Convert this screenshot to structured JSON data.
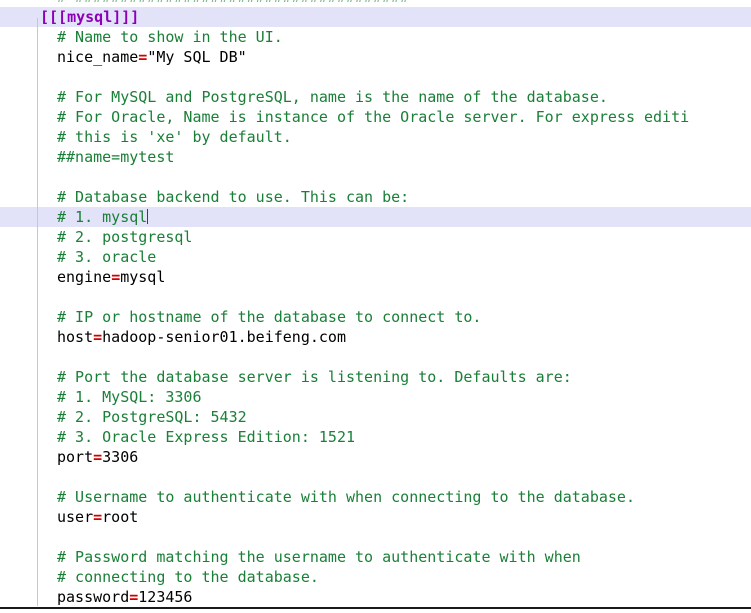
{
  "app": {
    "kind": "text-editor",
    "file_type": "ini-config",
    "background": "#ffffff",
    "highlight_color": "#e2e2f8",
    "comment_color": "#1a7f37",
    "section_color": "#8e00b8",
    "equals_color": "#d00000",
    "caret_color": "#3b2fb0"
  },
  "editor": {
    "clipped_top_line": "# #####################################",
    "lines": [
      {
        "id": "l1",
        "kind": "section",
        "indent": false,
        "highlight": true,
        "text": "[[[mysql]]]"
      },
      {
        "id": "l2",
        "kind": "comment",
        "indent": true,
        "highlight": false,
        "text": "# Name to show in the UI."
      },
      {
        "id": "l3",
        "kind": "assign",
        "indent": true,
        "highlight": false,
        "key": "nice_name",
        "eq": "=",
        "value": "\"My SQL DB\""
      },
      {
        "id": "l4",
        "kind": "blank",
        "indent": true,
        "highlight": false,
        "text": ""
      },
      {
        "id": "l5",
        "kind": "comment",
        "indent": true,
        "highlight": false,
        "text": "# For MySQL and PostgreSQL, name is the name of the database."
      },
      {
        "id": "l6",
        "kind": "comment",
        "indent": true,
        "highlight": false,
        "text": "# For Oracle, Name is instance of the Oracle server. For express editi"
      },
      {
        "id": "l7",
        "kind": "comment",
        "indent": true,
        "highlight": false,
        "text": "# this is 'xe' by default."
      },
      {
        "id": "l8",
        "kind": "comment",
        "indent": true,
        "highlight": false,
        "text": "##name=mytest"
      },
      {
        "id": "l9",
        "kind": "blank",
        "indent": true,
        "highlight": false,
        "text": ""
      },
      {
        "id": "l10",
        "kind": "comment",
        "indent": true,
        "highlight": false,
        "text": "# Database backend to use. This can be:"
      },
      {
        "id": "l11",
        "kind": "comment",
        "indent": true,
        "highlight": true,
        "caret": true,
        "text": "# 1. mysql"
      },
      {
        "id": "l12",
        "kind": "comment",
        "indent": true,
        "highlight": false,
        "text": "# 2. postgresql"
      },
      {
        "id": "l13",
        "kind": "comment",
        "indent": true,
        "highlight": false,
        "text": "# 3. oracle"
      },
      {
        "id": "l14",
        "kind": "assign",
        "indent": true,
        "highlight": false,
        "key": "engine",
        "eq": "=",
        "value": "mysql"
      },
      {
        "id": "l15",
        "kind": "blank",
        "indent": true,
        "highlight": false,
        "text": ""
      },
      {
        "id": "l16",
        "kind": "comment",
        "indent": true,
        "highlight": false,
        "text": "# IP or hostname of the database to connect to."
      },
      {
        "id": "l17",
        "kind": "assign",
        "indent": true,
        "highlight": false,
        "key": "host",
        "eq": "=",
        "value": "hadoop-senior01.beifeng.com"
      },
      {
        "id": "l18",
        "kind": "blank",
        "indent": true,
        "highlight": false,
        "text": ""
      },
      {
        "id": "l19",
        "kind": "comment",
        "indent": true,
        "highlight": false,
        "text": "# Port the database server is listening to. Defaults are:"
      },
      {
        "id": "l20",
        "kind": "comment",
        "indent": true,
        "highlight": false,
        "text": "# 1. MySQL: 3306"
      },
      {
        "id": "l21",
        "kind": "comment",
        "indent": true,
        "highlight": false,
        "text": "# 2. PostgreSQL: 5432"
      },
      {
        "id": "l22",
        "kind": "comment",
        "indent": true,
        "highlight": false,
        "text": "# 3. Oracle Express Edition: 1521"
      },
      {
        "id": "l23",
        "kind": "assign",
        "indent": true,
        "highlight": false,
        "key": "port",
        "eq": "=",
        "value": "3306"
      },
      {
        "id": "l24",
        "kind": "blank",
        "indent": true,
        "highlight": false,
        "text": ""
      },
      {
        "id": "l25",
        "kind": "comment",
        "indent": true,
        "highlight": false,
        "text": "# Username to authenticate with when connecting to the database."
      },
      {
        "id": "l26",
        "kind": "assign",
        "indent": true,
        "highlight": false,
        "key": "user",
        "eq": "=",
        "value": "root"
      },
      {
        "id": "l27",
        "kind": "blank",
        "indent": true,
        "highlight": false,
        "text": ""
      },
      {
        "id": "l28",
        "kind": "comment",
        "indent": true,
        "highlight": false,
        "text": "# Password matching the username to authenticate with when"
      },
      {
        "id": "l29",
        "kind": "comment",
        "indent": true,
        "highlight": false,
        "text": "# connecting to the database."
      },
      {
        "id": "l30",
        "kind": "assign",
        "indent": true,
        "highlight": false,
        "key": "password",
        "eq": "=",
        "value": "123456"
      }
    ]
  }
}
